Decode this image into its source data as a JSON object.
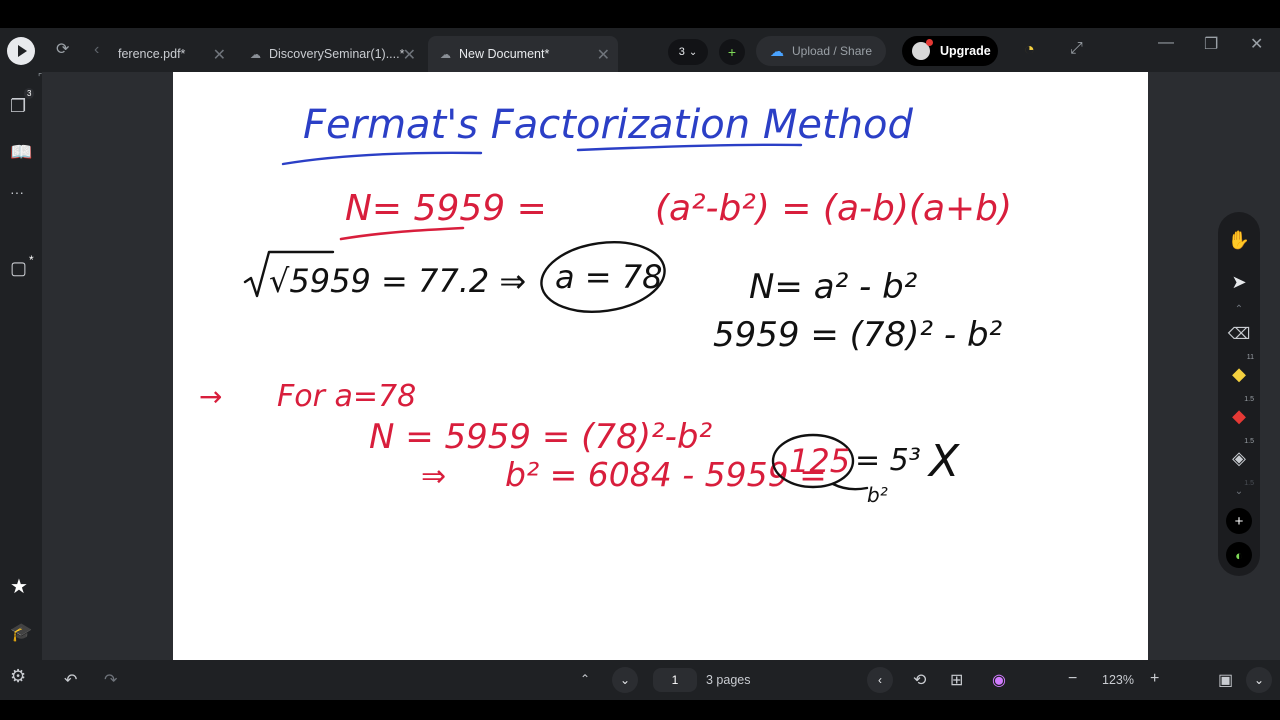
{
  "tabs": [
    {
      "label": "ference.pdf*",
      "active": false
    },
    {
      "label": "DiscoverySeminar(1)....*",
      "active": false
    },
    {
      "label": "New Document*",
      "active": true
    }
  ],
  "toolbar": {
    "page_dropdown": "3",
    "upload_label": "Upload / Share",
    "upgrade_label": "Upgrade",
    "avatar_badge": "1"
  },
  "sidebar": {
    "pages_badge": "3",
    "new_badge": "*"
  },
  "right_tools": {
    "highlighter_size": "11",
    "pen_size": "1.5",
    "lasso_size": "1.5",
    "extra_size": "1.5"
  },
  "bottom": {
    "current_page": "1",
    "pages_label": "3 pages",
    "zoom": "123%"
  },
  "colors": {
    "ink_blue": "#2b3fc6",
    "ink_red": "#d81e3c",
    "ink_black": "#111111",
    "app_bg": "#1f2124",
    "highlighter": "#f4d03f",
    "pen_red": "#e53935"
  },
  "notes": {
    "title": "Fermat's Factorization Method",
    "eq1_left": "N= 5959 =",
    "eq1_right": "(a²-b²) = (a-b)(a+b)",
    "eq2": "√5959 = 77.2 ⇒",
    "eq2_circled": "a = 78",
    "eq3": "N= a² - b²",
    "eq4": "5959 = (78)² - b²",
    "arrow1": "→",
    "eq5": "For a=78",
    "eq6": "N = 5959 = (78)²-b²",
    "eq7_arrow": "⇒",
    "eq7": "b² = 6084 - 5959 =",
    "eq7_circled": "125",
    "eq7_tail": "= 5³",
    "eq7_note": "b²",
    "cross": "X"
  }
}
